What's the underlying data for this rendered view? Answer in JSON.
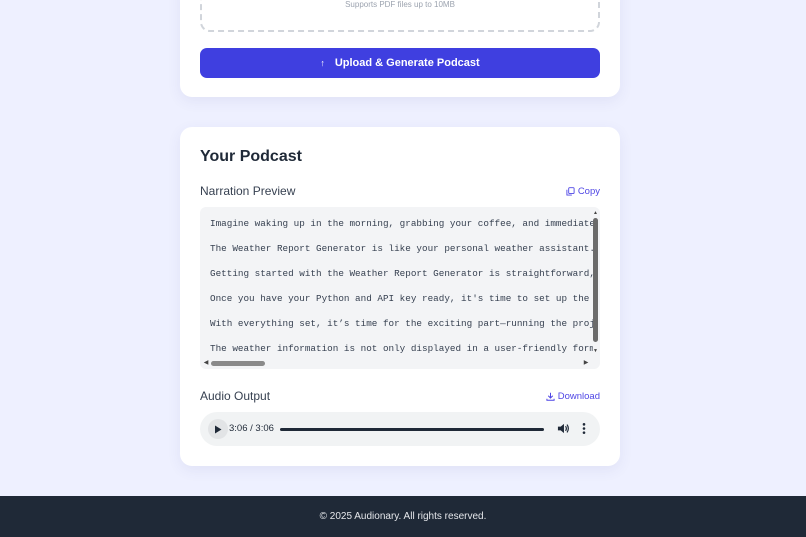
{
  "upload": {
    "hint": "Supports PDF files up to 10MB",
    "button_label": "Upload & Generate Podcast"
  },
  "podcast": {
    "title": "Your Podcast",
    "narration_label": "Narration Preview",
    "copy_label": "Copy",
    "narration_lines": [
      "Imagine waking up in the morning, grabbing your coffee, and immediately w",
      "The Weather Report Generator is like your personal weather assistant. It",
      "Getting started with the Weather Report Generator is straightforward, but",
      "Once you have your Python and API key ready, it's time to set up the tool",
      "With everything set, it’s time for the exciting part—running the project.",
      "The weather information is not only displayed in a user-friendly format c"
    ],
    "audio_label": "Audio Output",
    "download_label": "Download",
    "audio": {
      "time": "3:06 / 3:06",
      "progress": 1.0
    }
  },
  "footer": {
    "text": "© 2025 Audionary. All rights reserved."
  },
  "colors": {
    "accent": "#3f3fe0",
    "link": "#4f46e5",
    "background": "#eef0ff",
    "footer_bg": "#1f2937"
  }
}
